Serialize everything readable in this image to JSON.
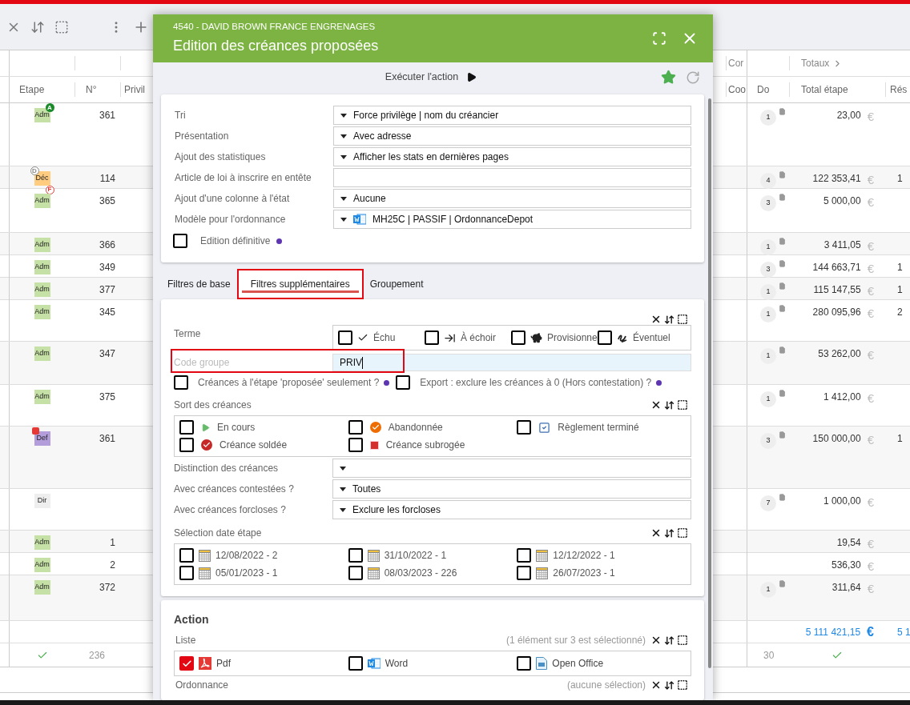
{
  "table": {
    "group_headers": {
      "column_9": "Cor",
      "totals": "Totaux"
    },
    "columns": {
      "stage": "Etape",
      "number": "N°",
      "column_4": "Privil",
      "column_9": "Coo",
      "docs": "Do",
      "total": "Total étape",
      "rest": "Rés"
    },
    "rows": [
      {
        "stage": {
          "label": "Adm",
          "color": "#c5e1a5"
        },
        "badges": [
          {
            "kind": "filled",
            "letter": "A",
            "color": "#1b8a2a"
          }
        ],
        "number": "361",
        "docs": "1",
        "total": "23,00",
        "currency": "€"
      },
      {
        "stage": {
          "label": "Déc",
          "color": "#ffcc80"
        },
        "badges": [
          {
            "kind": "outline-top",
            "letter": "D",
            "color": "#8a8a8a"
          },
          {
            "kind": "outline-bottom",
            "letter": "F",
            "color": "#e53935"
          }
        ],
        "number": "114",
        "docs": "4",
        "total": "122 353,41",
        "currency": "€",
        "rest": "1"
      },
      {
        "stage": {
          "label": "Adm",
          "color": "#c5e1a5"
        },
        "number": "365",
        "docs": "3",
        "total": "5 000,00",
        "currency": "€"
      },
      {
        "stage": {
          "label": "Adm",
          "color": "#c5e1a5"
        },
        "number": "366",
        "docs": "1",
        "total": "3 411,05",
        "currency": "€"
      },
      {
        "stage": {
          "label": "Adm",
          "color": "#c5e1a5"
        },
        "number": "349",
        "docs": "3",
        "total": "144 663,71",
        "currency": "€",
        "rest": "1"
      },
      {
        "stage": {
          "label": "Adm",
          "color": "#c5e1a5"
        },
        "number": "377",
        "docs": "1",
        "total": "115 147,55",
        "currency": "€",
        "rest": "1"
      },
      {
        "stage": {
          "label": "Adm",
          "color": "#c5e1a5"
        },
        "number": "345",
        "docs": "1",
        "total": "280 095,96",
        "currency": "€",
        "rest": "2"
      },
      {
        "stage": {
          "label": "Adm",
          "color": "#c5e1a5"
        },
        "number": "347",
        "docs": "1",
        "total": "53 262,00",
        "currency": "€"
      },
      {
        "stage": {
          "label": "Adm",
          "color": "#c5e1a5"
        },
        "number": "375",
        "docs": "1",
        "total": "1 412,00",
        "currency": "€"
      },
      {
        "stage": {
          "label": "Def",
          "color": "#b39ddb"
        },
        "badges": [
          {
            "kind": "person",
            "color": "#e53935"
          }
        ],
        "number": "361",
        "docs": "3",
        "total": "150 000,00",
        "currency": "€",
        "rest": "1"
      },
      {
        "stage": {
          "label": "Dir",
          "color": "#eeeeee"
        },
        "docs": "7",
        "total": "1 000,00",
        "currency": "€"
      },
      {
        "stage": {
          "label": "Adm",
          "color": "#c5e1a5"
        },
        "number": "1",
        "total": "19,54",
        "currency": "€"
      },
      {
        "stage": {
          "label": "Adm",
          "color": "#c5e1a5"
        },
        "number": "2",
        "total": "536,30",
        "currency": "€"
      },
      {
        "stage": {
          "label": "Adm",
          "color": "#c5e1a5"
        },
        "number": "372",
        "docs": "1",
        "total": "311,64",
        "currency": "€"
      }
    ],
    "totals_row": {
      "total": "5 111 421,15",
      "currency": "€",
      "rest": "5 1"
    },
    "footer": {
      "number": "236",
      "docs": "30"
    }
  },
  "dialog": {
    "subtitle": "4540 - DAVID BROWN FRANCE ENGRENAGES",
    "title": "Edition des créances proposées",
    "action": "Exécuter l'action",
    "options": [
      {
        "label": "Tri",
        "kind": "select",
        "value": "Force privilège | nom du créancier"
      },
      {
        "label": "Présentation",
        "kind": "select",
        "value": "Avec adresse"
      },
      {
        "label": "Ajout des statistiques",
        "kind": "select",
        "value": "Afficher les stats en dernières pages"
      },
      {
        "label": "Article de loi à inscrire en entête",
        "kind": "text"
      },
      {
        "label": "Ajout d'une colonne à l'état",
        "kind": "select",
        "value": "Aucune"
      },
      {
        "label": "Modèle pour l'ordonnance",
        "kind": "select-word",
        "value": "MH25C | PASSIF | OrdonnanceDepot"
      }
    ],
    "final_edition": {
      "label": "Edition définitive",
      "checked": false
    },
    "tabs": [
      {
        "label": "Filtres de base",
        "selected": false,
        "highlighted": false
      },
      {
        "label": "Filtres supplémentaires",
        "selected": true,
        "highlighted": true
      },
      {
        "label": "Groupement",
        "selected": false,
        "highlighted": false
      }
    ],
    "term": {
      "label": "Terme",
      "options": [
        {
          "label": "Échu",
          "kind": "check",
          "checked": false
        },
        {
          "label": "À échoir",
          "kind": "arrow",
          "checked": false
        },
        {
          "label": "Provisionne",
          "kind": "piggy",
          "checked": false
        },
        {
          "label": "Éventuel",
          "kind": "squiggle",
          "checked": false
        }
      ]
    },
    "code_group": {
      "label": "Code groupe",
      "value": "PRIV",
      "highlighted": true
    },
    "flags": [
      {
        "label": "Créances à l'étape 'proposée' seulement ?",
        "checked": false
      },
      {
        "label": "Export : exclure les créances à 0 (Hors contestation) ?",
        "checked": false
      }
    ],
    "outcome": {
      "label": "Sort des créances",
      "options": [
        {
          "label": "En cours",
          "kind": "play",
          "checked": false
        },
        {
          "label": "Abandonnée",
          "kind": "orange-check",
          "checked": false
        },
        {
          "label": "Règlement terminé",
          "kind": "box-check",
          "checked": false
        },
        {
          "label": "Créance soldée",
          "kind": "red-check",
          "checked": false
        },
        {
          "label": "Créance subrogée",
          "kind": "red-square",
          "checked": false
        }
      ]
    },
    "selects": [
      {
        "label": "Distinction des créances"
      },
      {
        "label": "Avec créances contestées ?",
        "value": "Toutes"
      },
      {
        "label": "Avec créances forcloses ?",
        "value": "Exclure les forcloses"
      }
    ],
    "dates": {
      "label": "Sélection date étape",
      "options": [
        {
          "label": "12/08/2022 - 2",
          "checked": false
        },
        {
          "label": "31/10/2022 - 1",
          "checked": false
        },
        {
          "label": "12/12/2022 - 1",
          "checked": false
        },
        {
          "label": "05/01/2023 - 1",
          "checked": false
        },
        {
          "label": "08/03/2023 - 226",
          "checked": false
        },
        {
          "label": "26/07/2023 - 1",
          "checked": false
        }
      ]
    },
    "action_section": {
      "title": "Action",
      "list": {
        "label": "Liste",
        "summary": "(1 élément sur 3 est sélectionné)",
        "options": [
          {
            "label": "Pdf",
            "kind": "pdf",
            "checked": true
          },
          {
            "label": "Word",
            "kind": "word",
            "checked": false
          },
          {
            "label": "Open Office",
            "kind": "office",
            "checked": false
          }
        ]
      },
      "next": {
        "label": "Ordonnance",
        "summary": "(aucune sélection)"
      }
    }
  }
}
